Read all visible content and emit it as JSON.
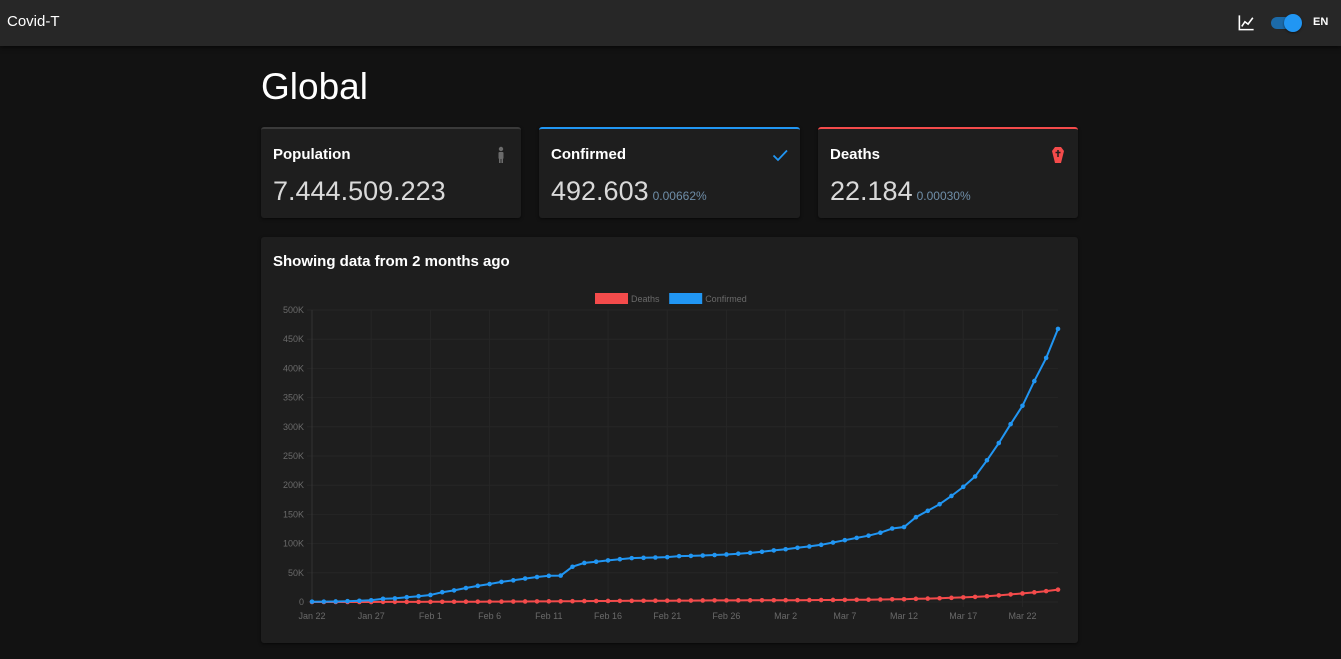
{
  "app": {
    "title": "Covid-T",
    "lang": "EN",
    "dark_mode": true
  },
  "page": {
    "title": "Global"
  },
  "cards": {
    "population": {
      "label": "Population",
      "value": "7.444.509.223",
      "icon": "person-icon"
    },
    "confirmed": {
      "label": "Confirmed",
      "value": "492.603",
      "pct": "0.00662%",
      "icon": "check-icon",
      "color": "#2196f3"
    },
    "deaths": {
      "label": "Deaths",
      "value": "22.184",
      "pct": "0.00030%",
      "icon": "coffin-icon",
      "color": "#f44b4b"
    }
  },
  "chart": {
    "title": "Showing data from 2 months ago"
  },
  "chart_data": {
    "type": "line",
    "x": [
      "Jan 22",
      "Jan 23",
      "Jan 24",
      "Jan 25",
      "Jan 26",
      "Jan 27",
      "Jan 28",
      "Jan 29",
      "Jan 30",
      "Jan 31",
      "Feb 1",
      "Feb 2",
      "Feb 3",
      "Feb 4",
      "Feb 5",
      "Feb 6",
      "Feb 7",
      "Feb 8",
      "Feb 9",
      "Feb 10",
      "Feb 11",
      "Feb 12",
      "Feb 13",
      "Feb 14",
      "Feb 15",
      "Feb 16",
      "Feb 17",
      "Feb 18",
      "Feb 19",
      "Feb 20",
      "Feb 21",
      "Feb 22",
      "Feb 23",
      "Feb 24",
      "Feb 25",
      "Feb 26",
      "Feb 27",
      "Feb 28",
      "Feb 29",
      "Mar 1",
      "Mar 2",
      "Mar 3",
      "Mar 4",
      "Mar 5",
      "Mar 6",
      "Mar 7",
      "Mar 8",
      "Mar 9",
      "Mar 10",
      "Mar 11",
      "Mar 12",
      "Mar 13",
      "Mar 14",
      "Mar 15",
      "Mar 16",
      "Mar 17",
      "Mar 18",
      "Mar 19",
      "Mar 20",
      "Mar 21",
      "Mar 22",
      "Mar 23",
      "Mar 24",
      "Mar 25"
    ],
    "x_tick_labels": [
      "Jan 22",
      "Jan 27",
      "Feb 1",
      "Feb 6",
      "Feb 11",
      "Feb 16",
      "Feb 21",
      "Feb 26",
      "Mar 2",
      "Mar 7",
      "Mar 12",
      "Mar 17",
      "Mar 22"
    ],
    "series": [
      {
        "name": "Deaths",
        "color": "#f44b4b",
        "values": [
          17,
          18,
          26,
          42,
          56,
          82,
          131,
          133,
          171,
          213,
          259,
          362,
          426,
          492,
          564,
          634,
          719,
          806,
          906,
          1013,
          1113,
          1118,
          1371,
          1523,
          1666,
          1770,
          1868,
          2007,
          2122,
          2247,
          2251,
          2458,
          2469,
          2629,
          2708,
          2770,
          2814,
          2872,
          2941,
          2996,
          3085,
          3160,
          3254,
          3348,
          3460,
          3558,
          3802,
          3988,
          4262,
          4615,
          4720,
          5404,
          5819,
          6440,
          7126,
          7905,
          8733,
          9867,
          11299,
          12973,
          14651,
          16505,
          18625,
          21181
        ]
      },
      {
        "name": "Confirmed",
        "color": "#2196f3",
        "values": [
          555,
          654,
          941,
          1434,
          2118,
          2927,
          5578,
          6166,
          8234,
          9927,
          12038,
          16787,
          19881,
          23892,
          27635,
          30794,
          34391,
          37120,
          40150,
          42762,
          44802,
          45221,
          60368,
          66885,
          69030,
          71224,
          73258,
          75136,
          75639,
          76197,
          76819,
          78572,
          78958,
          79561,
          80406,
          81388,
          82746,
          84112,
          86011,
          88369,
          90306,
          92840,
          95120,
          97886,
          101801,
          105847,
          109821,
          113590,
          118620,
          125875,
          128343,
          145193,
          156099,
          167447,
          181546,
          197168,
          214915,
          242713,
          272167,
          304528,
          335957,
          378287,
          417966,
          467594
        ]
      }
    ],
    "y_ticks": [
      0,
      50000,
      100000,
      150000,
      200000,
      250000,
      300000,
      350000,
      400000,
      450000,
      500000
    ],
    "y_tick_labels": [
      "0",
      "50K",
      "100K",
      "150K",
      "200K",
      "250K",
      "300K",
      "350K",
      "400K",
      "450K",
      "500K"
    ],
    "ylim": [
      0,
      500000
    ],
    "legend": "top",
    "grid": true
  }
}
